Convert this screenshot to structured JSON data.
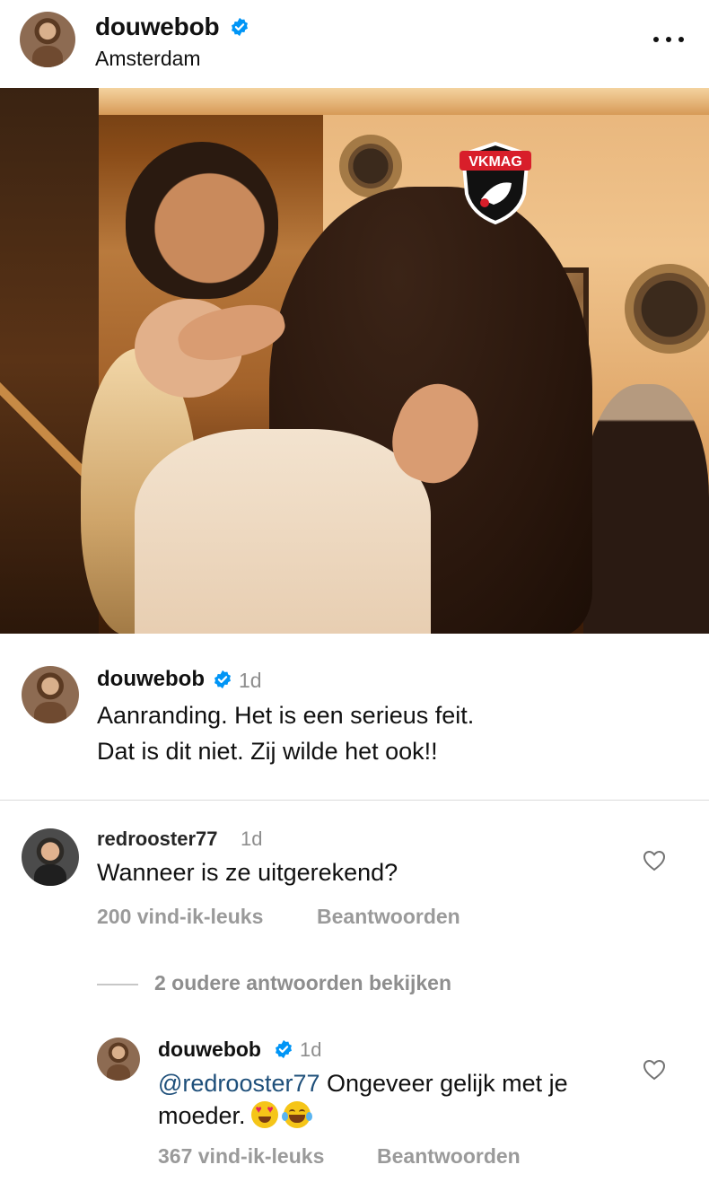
{
  "post": {
    "username": "douwebob",
    "location": "Amsterdam",
    "more_icon": "more-horizontal-icon",
    "watermark_text": "VKMAG"
  },
  "caption": {
    "username": "douwebob",
    "time": "1d",
    "line1": "Aanranding. Het is een serieus feit.",
    "line2": "Dat is dit niet. Zij wilde het ook!!"
  },
  "comments": [
    {
      "username": "redrooster77",
      "time": "1d",
      "text": "Wanneer is ze uitgerekend?",
      "likes": "200 vind-ik-leuks",
      "reply_label": "Beantwoorden",
      "view_replies": "2 oudere antwoorden bekijken",
      "replies": [
        {
          "username": "douwebob",
          "time": "1d",
          "mention": "@redrooster77",
          "text_line1": " Ongeveer gelijk met je",
          "text_line2": "moeder.",
          "emojis": [
            "heart-eyes-emoji",
            "tears-of-joy-emoji"
          ],
          "likes": "367 vind-ik-leuks",
          "reply_label": "Beantwoorden"
        }
      ]
    }
  ],
  "colors": {
    "verified": "#0095f6",
    "muted": "#8e8e8e",
    "mention": "#1e4f7a"
  }
}
